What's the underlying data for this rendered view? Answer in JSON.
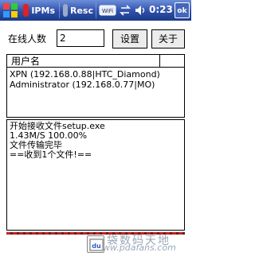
{
  "taskbar": {
    "tab1_label": "IPMs",
    "tab2_label": "Resc",
    "clock": "0:23",
    "ok_label": "ok"
  },
  "form": {
    "online_label": "在线人数",
    "online_value": "2",
    "settings_button": "设置",
    "about_button": "关于"
  },
  "list": {
    "header": "用户名",
    "rows": [
      "XPN (192.168.0.88|HTC_Diamond)",
      "Administrator (192.168.0.77|MO)"
    ]
  },
  "log": {
    "lines": [
      "开始接收文件setup.exe",
      "1.43M/S 100.00%",
      "文件传输完毕",
      "==收到1个文件!=="
    ]
  },
  "watermark": {
    "text": "口袋数码天地",
    "url": "www.pdafans.com"
  },
  "sip": {
    "label": "du"
  }
}
